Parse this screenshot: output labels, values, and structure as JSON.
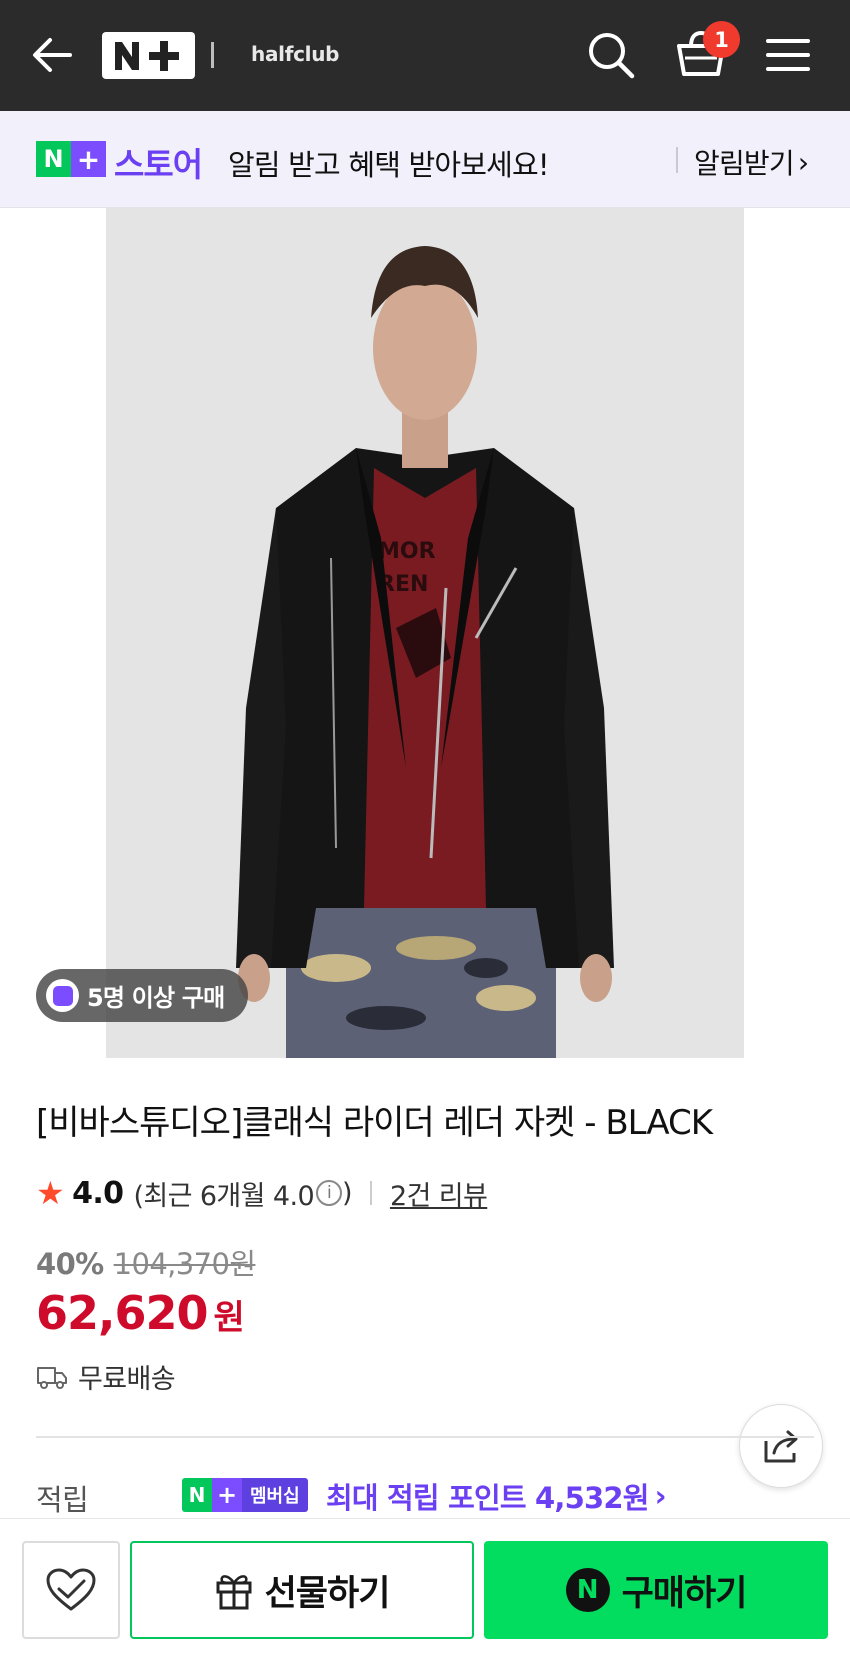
{
  "header": {
    "shop_name": "halfclub",
    "cart_count": "1",
    "icons": [
      "back-arrow-icon",
      "search-icon",
      "cart-icon",
      "menu-icon"
    ]
  },
  "banner": {
    "brand_n": "N",
    "brand_plus": "+",
    "store_label": "스토어",
    "message": "알림 받고 혜택 받아보세요!",
    "action_label": "알림받기",
    "action_chevron": "›"
  },
  "product": {
    "popularity_badge": "5명 이상 구매",
    "title": "[비바스튜디오]클래식 라이더 레더 자켓 - BLACK",
    "rating": {
      "star": "★",
      "score": "4.0",
      "recent_prefix": "(최근 6개월 4.0",
      "recent_info": "i",
      "recent_suffix": ")",
      "review_link": "2건 리뷰"
    },
    "discount_percent": "40%",
    "original_price": "104,370원",
    "sale_price": "62,620",
    "currency": "원",
    "shipping": "무료배송"
  },
  "points": {
    "label": "적립",
    "badge_n": "N",
    "badge_plus": "+",
    "badge_text": "멤버십",
    "text": "최대 적립 포인트 4,532원",
    "chevron": "›"
  },
  "actions": {
    "gift_label": "선물하기",
    "buy_icon": "N",
    "buy_label": "구매하기"
  },
  "colors": {
    "header_bg": "#2b2b2b",
    "naver_green": "#03c75a",
    "naver_purple": "#7b4dff",
    "price_red": "#cf0b2b",
    "buy_green": "#03dd5f"
  }
}
